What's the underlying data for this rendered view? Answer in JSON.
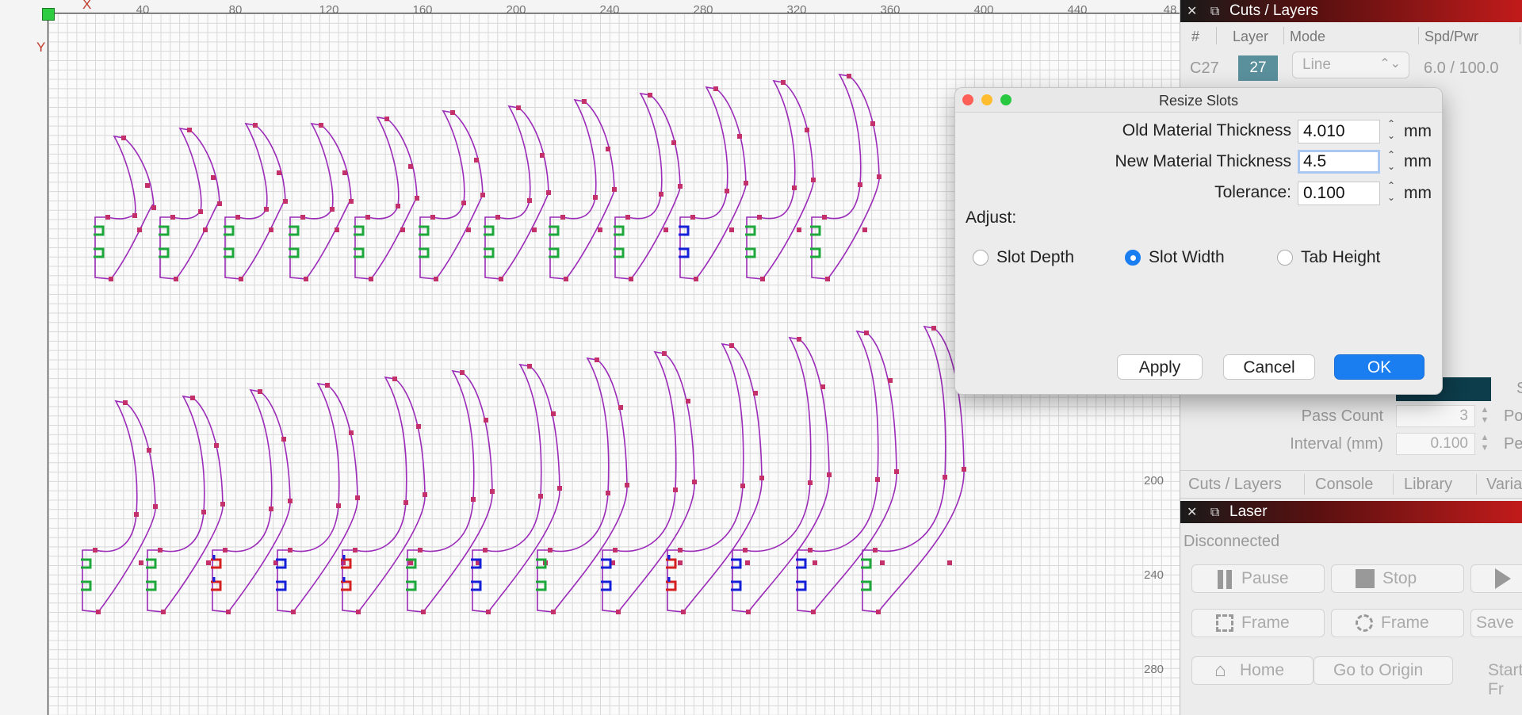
{
  "canvas": {
    "axis_x_label": "X",
    "axis_y_label": "Y",
    "top_ticks": [
      "40",
      "80",
      "120",
      "160",
      "200",
      "240",
      "280",
      "320",
      "360",
      "400",
      "440",
      "48"
    ],
    "right_ticks": [
      "200",
      "240",
      "280"
    ]
  },
  "colors": {
    "outline": "#9b2bb8",
    "node": "#c4306a",
    "tab_green": "#1ea83c",
    "tab_blue": "#1520d8",
    "tab_red": "#d42020"
  },
  "cuts_panel": {
    "title": "Cuts / Layers",
    "columns": [
      "#",
      "Layer",
      "Mode",
      "Spd/Pwr"
    ],
    "row": {
      "id": "C27",
      "layer": "27",
      "mode": "Line",
      "speed_power": "6.0 / 100.0"
    },
    "pass_count_label": "Pass Count",
    "pass_count_value": "3",
    "interval_label": "Interval (mm)",
    "interval_value": "0.100",
    "trunc_1": "S",
    "trunc_2": "Po",
    "trunc_3": "Pe"
  },
  "tabs": [
    "Cuts / Layers",
    "Console",
    "Library",
    "Varia"
  ],
  "laser_panel": {
    "title": "Laser",
    "status": "Disconnected",
    "pause_label": "Pause",
    "stop_label": "Stop",
    "frame_rect_label": "Frame",
    "frame_circle_label": "Frame",
    "save_label": "Save",
    "home_label": "Home",
    "origin_label": "Go to Origin",
    "start_label": "Start Fr"
  },
  "dialog": {
    "title": "Resize Slots",
    "old_label": "Old Material Thickness",
    "old_value": "4.010",
    "new_label": "New Material Thickness",
    "new_value": "4.5",
    "tol_label": "Tolerance:",
    "tol_value": "0.100",
    "unit": "mm",
    "adjust_label": "Adjust:",
    "radio_depth": "Slot Depth",
    "radio_width": "Slot Width",
    "radio_height": "Tab Height",
    "selected": "Slot Width",
    "apply_label": "Apply",
    "cancel_label": "Cancel",
    "ok_label": "OK"
  }
}
